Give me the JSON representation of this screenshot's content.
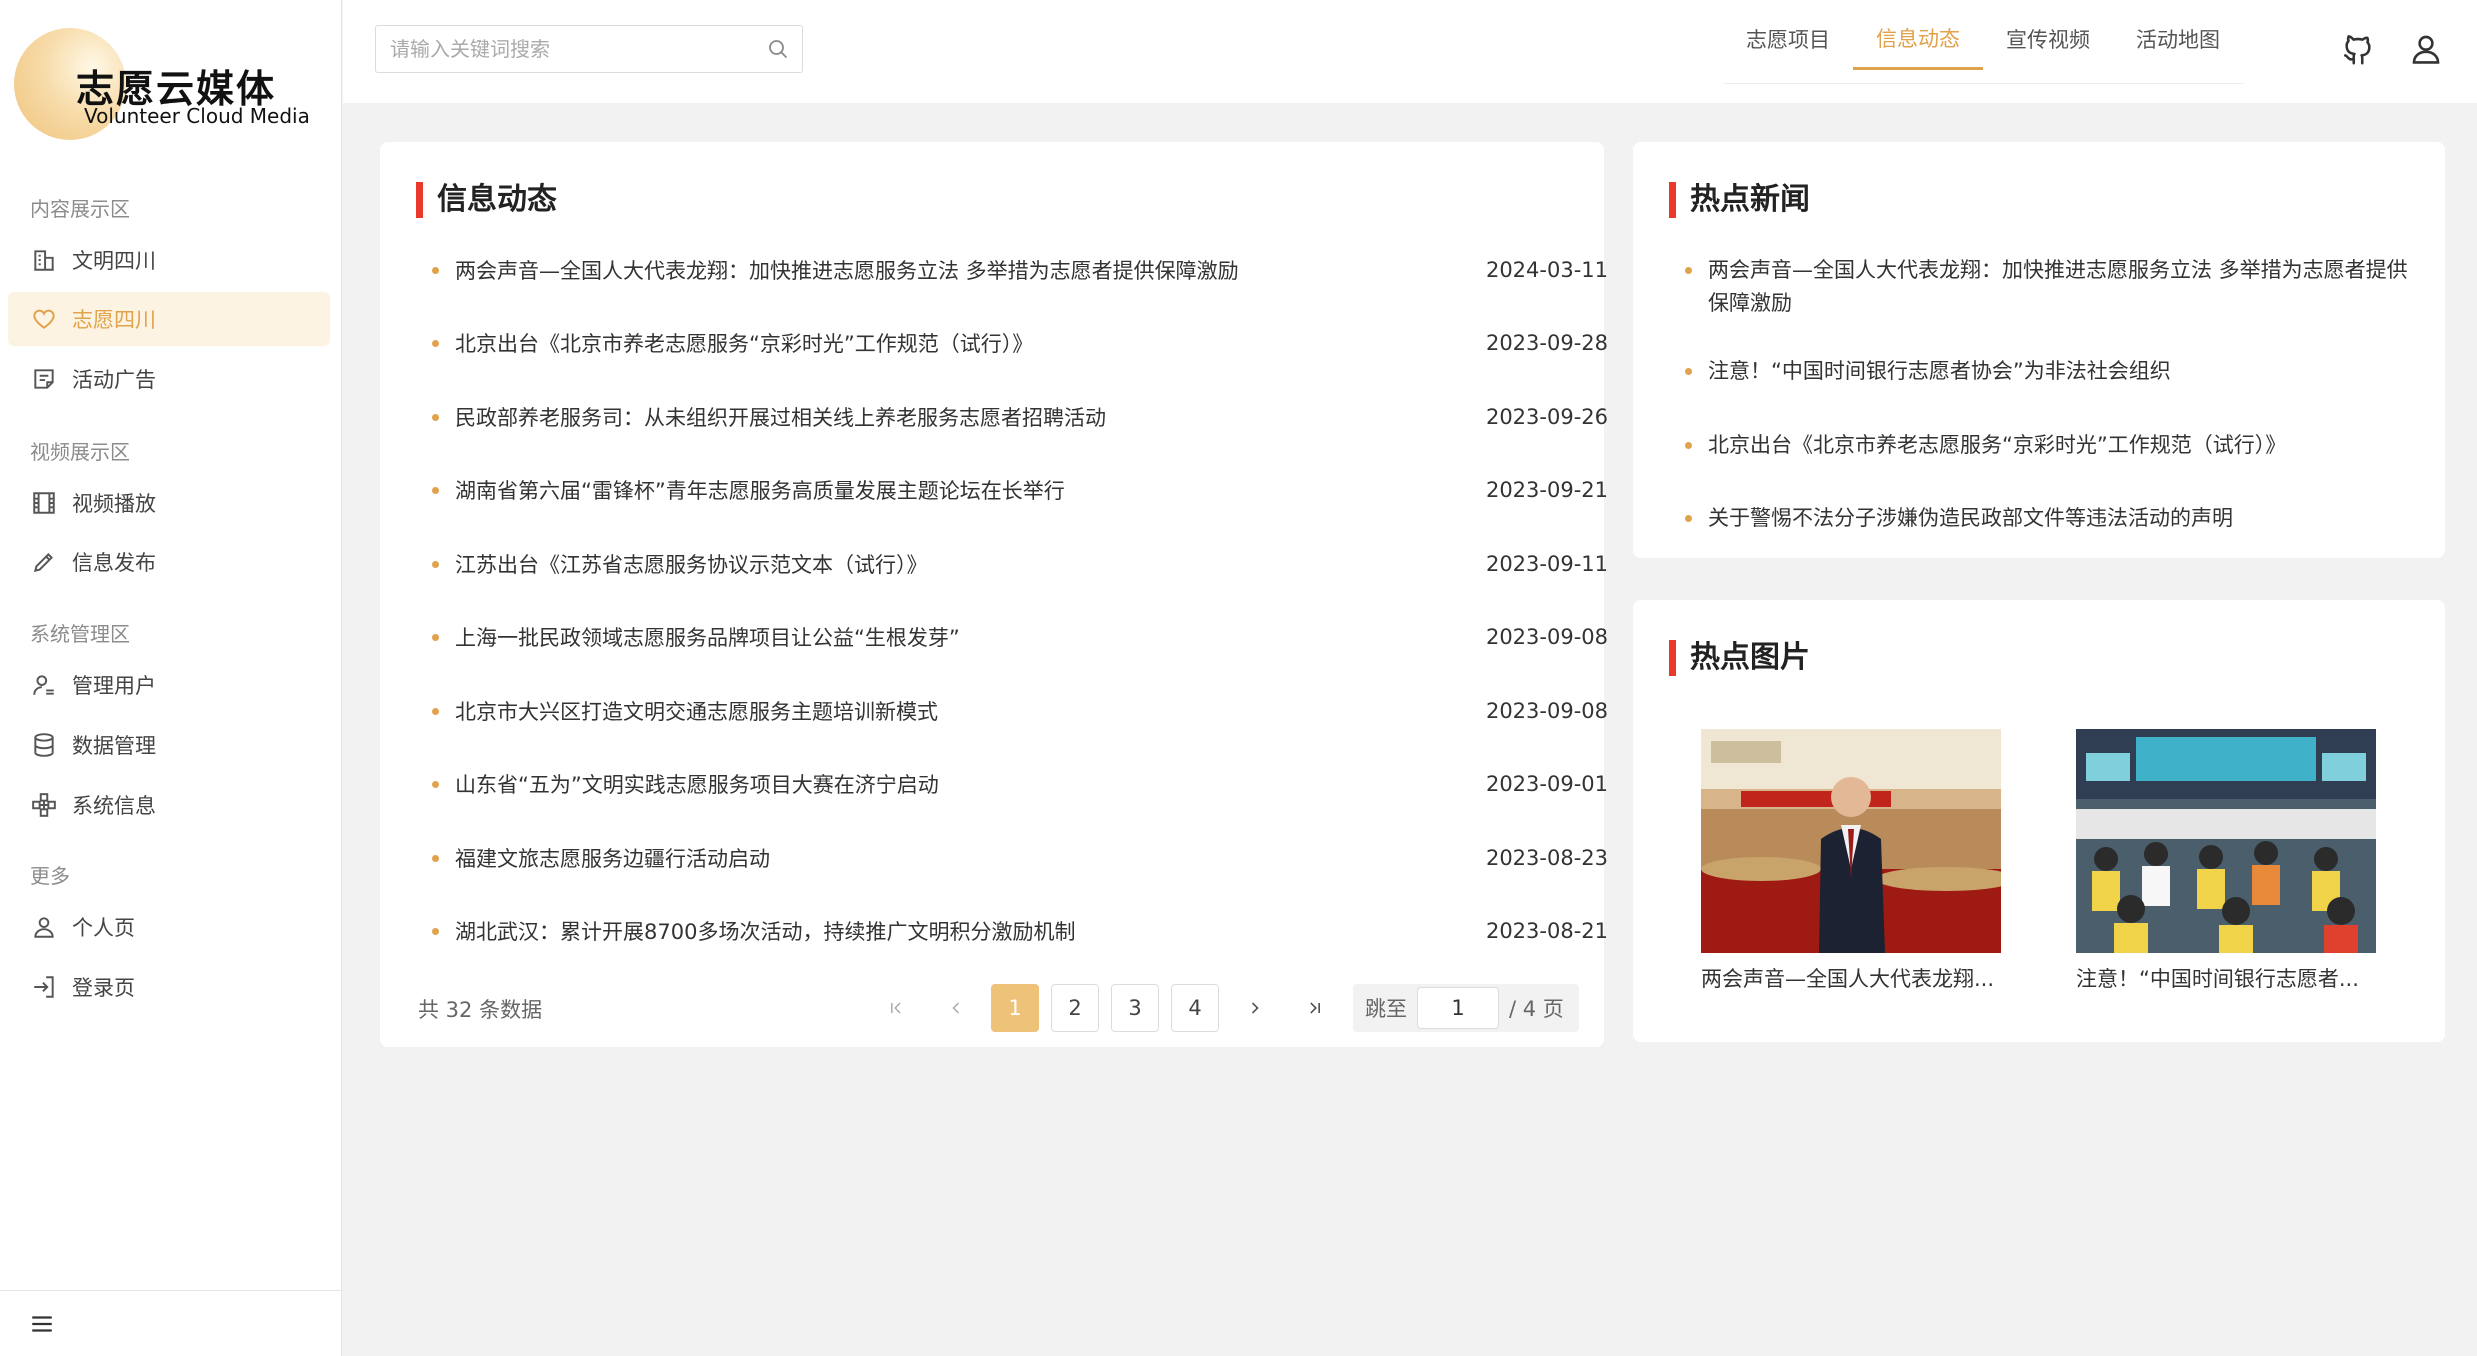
{
  "brand": {
    "title": "志愿云媒体",
    "subtitle": "Volunteer Cloud Media"
  },
  "sidebar": {
    "groups": [
      {
        "label": "内容展示区",
        "items": [
          {
            "label": "文明四川",
            "icon": "building-icon"
          },
          {
            "label": "志愿四川",
            "icon": "heart-icon",
            "active": true
          },
          {
            "label": "活动广告",
            "icon": "document-icon"
          }
        ]
      },
      {
        "label": "视频展示区",
        "items": [
          {
            "label": "视频播放",
            "icon": "film-icon"
          },
          {
            "label": "信息发布",
            "icon": "pencil-icon"
          }
        ]
      },
      {
        "label": "系统管理区",
        "items": [
          {
            "label": "管理用户",
            "icon": "user-manage-icon"
          },
          {
            "label": "数据管理",
            "icon": "database-icon"
          },
          {
            "label": "系统信息",
            "icon": "cluster-icon"
          }
        ]
      },
      {
        "label": "更多",
        "items": [
          {
            "label": "个人页",
            "icon": "user-icon"
          },
          {
            "label": "登录页",
            "icon": "login-icon"
          }
        ]
      }
    ]
  },
  "header": {
    "search_placeholder": "请输入关键词搜索",
    "tabs": [
      {
        "label": "志愿项目"
      },
      {
        "label": "信息动态",
        "active": true
      },
      {
        "label": "宣传视频"
      },
      {
        "label": "活动地图"
      }
    ]
  },
  "news": {
    "title": "信息动态",
    "items": [
      {
        "title": "两会声音—全国人大代表龙翔：加快推进志愿服务立法 多举措为志愿者提供保障激励",
        "date": "2024-03-11"
      },
      {
        "title": "北京出台《北京市养老志愿服务“京彩时光”工作规范（试行）》",
        "date": "2023-09-28"
      },
      {
        "title": "民政部养老服务司：从未组织开展过相关线上养老服务志愿者招聘活动",
        "date": "2023-09-26"
      },
      {
        "title": "湖南省第六届“雷锋杯”青年志愿服务高质量发展主题论坛在长举行",
        "date": "2023-09-21"
      },
      {
        "title": "江苏出台《江苏省志愿服务协议示范文本（试行）》",
        "date": "2023-09-11"
      },
      {
        "title": "上海一批民政领域志愿服务品牌项目让公益“生根发芽”",
        "date": "2023-09-08"
      },
      {
        "title": "北京市大兴区打造文明交通志愿服务主题培训新模式",
        "date": "2023-09-08"
      },
      {
        "title": "山东省“五为”文明实践志愿服务项目大赛在济宁启动",
        "date": "2023-09-01"
      },
      {
        "title": "福建文旅志愿服务边疆行活动启动",
        "date": "2023-08-23"
      },
      {
        "title": "湖北武汉：累计开展8700多场次活动，持续推广文明积分激励机制",
        "date": "2023-08-21"
      }
    ],
    "pagination": {
      "total_text": "共 32 条数据",
      "pages": [
        "1",
        "2",
        "3",
        "4"
      ],
      "current": "1",
      "jump_label": "跳至",
      "jump_value": "1",
      "jump_suffix": "/ 4 页"
    }
  },
  "hot_news": {
    "title": "热点新闻",
    "items": [
      {
        "title": "两会声音—全国人大代表龙翔：加快推进志愿服务立法 多举措为志愿者提供保障激励"
      },
      {
        "title": "注意！“中国时间银行志愿者协会”为非法社会组织"
      },
      {
        "title": "北京出台《北京市养老志愿服务“京彩时光”工作规范（试行）》"
      },
      {
        "title": "关于警惕不法分子涉嫌伪造民政部文件等违法活动的声明"
      }
    ]
  },
  "hot_pics": {
    "title": "热点图片",
    "items": [
      {
        "caption": "两会声音—全国人大代表龙翔..."
      },
      {
        "caption": "注意！“中国时间银行志愿者..."
      }
    ]
  },
  "colors": {
    "accent": "#e0a24a",
    "title_bar": "#e8392b",
    "current_page": "#efc27a"
  }
}
